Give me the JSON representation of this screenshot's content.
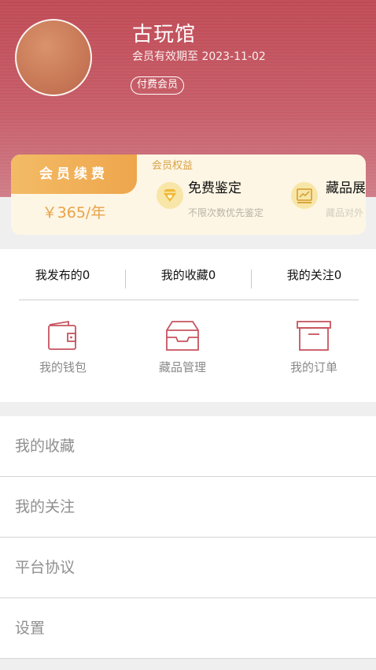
{
  "profile": {
    "name": "古玩馆",
    "expiry": "会员有效期至 2023-11-02",
    "badge": "付费会员"
  },
  "membership": {
    "renew_label": "会员续费",
    "renew_price": "￥365/年",
    "benefits_title": "会员权益",
    "benefits": [
      {
        "icon": "diamond-heart-icon",
        "name": "免费鉴定",
        "desc": "不限次数优先鉴定"
      },
      {
        "icon": "chart-board-icon",
        "name": "藏品展",
        "desc": "藏品对外"
      }
    ]
  },
  "stats": [
    {
      "label": "我发布的0"
    },
    {
      "label": "我的收藏0"
    },
    {
      "label": "我的关注0"
    }
  ],
  "tools": [
    {
      "icon": "wallet-icon",
      "label": "我的钱包"
    },
    {
      "icon": "inbox-tray-icon",
      "label": "藏品管理"
    },
    {
      "icon": "archive-box-icon",
      "label": "我的订单"
    }
  ],
  "menu": [
    {
      "label": "我的收藏"
    },
    {
      "label": "我的关注"
    },
    {
      "label": "平台协议"
    },
    {
      "label": "设置"
    }
  ],
  "colors": {
    "header": "#c65d68",
    "accent_gold": "#eea64c",
    "icon_red": "#c6545f"
  }
}
